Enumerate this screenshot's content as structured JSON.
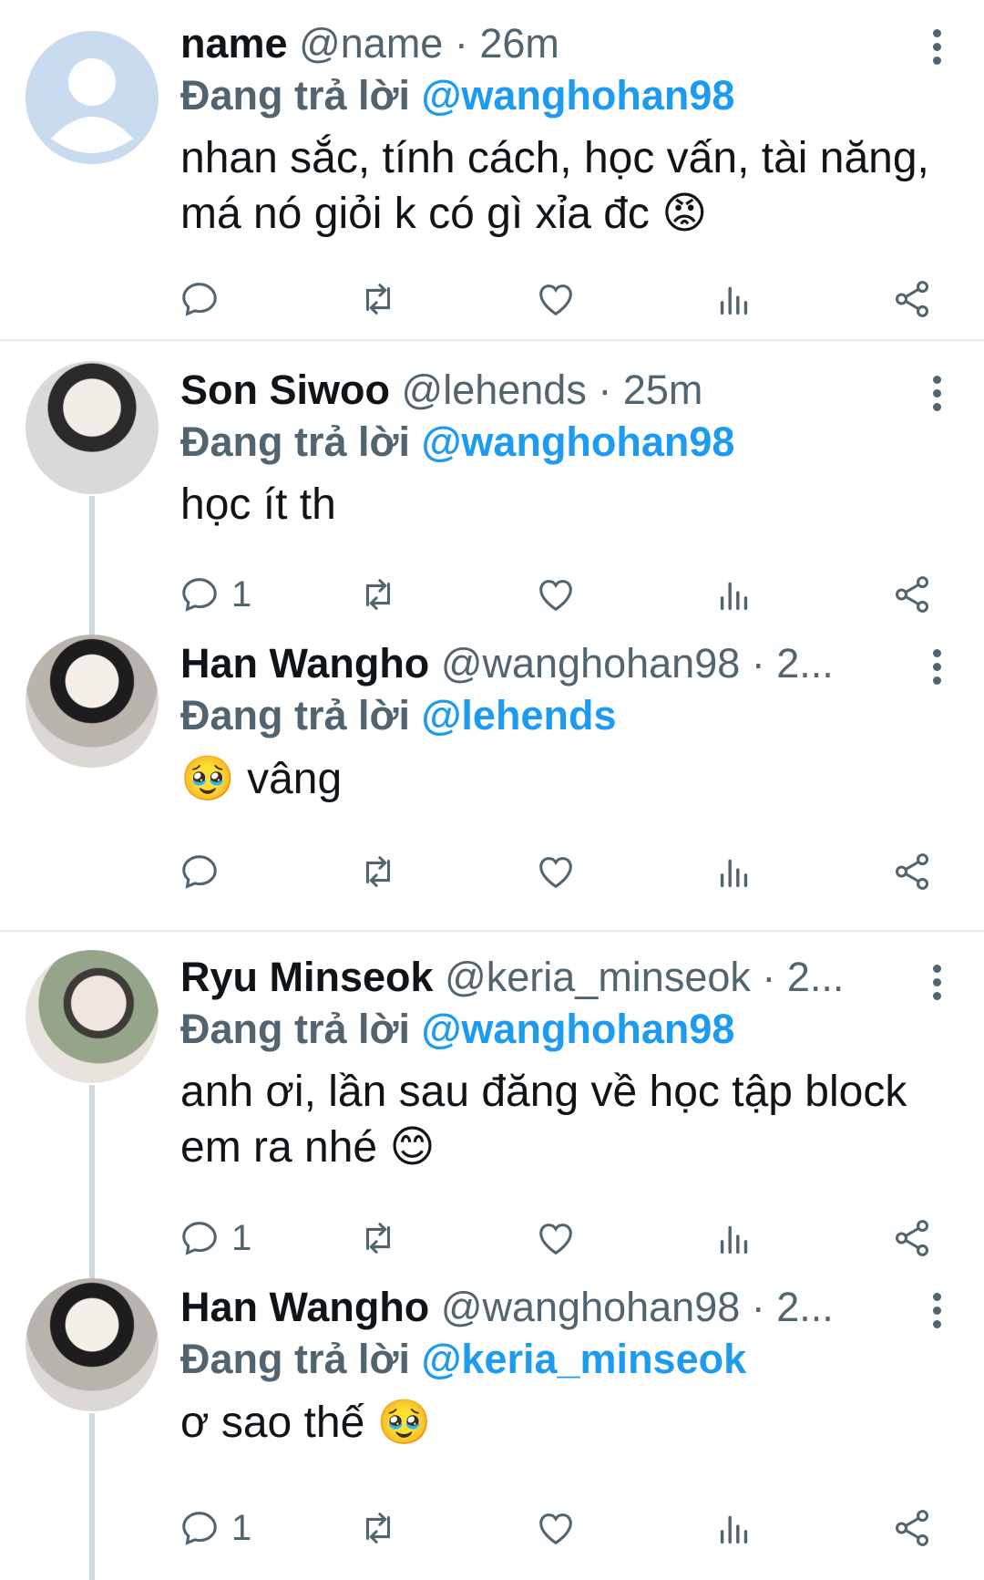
{
  "reply_prefix": "Đang trả lời",
  "tweets": [
    {
      "name": "name",
      "handle": "@name",
      "time": "· 26m",
      "reply_to": "@wanghohan98",
      "text": "nhan sắc, tính cách, học vấn, tài năng, má nó giỏi k có gì xỉa đc",
      "emoji": "😡",
      "reply_count": ""
    },
    {
      "name": "Son Siwoo",
      "handle": "@lehends",
      "time": "· 25m",
      "reply_to": "@wanghohan98",
      "text": "học ít th",
      "emoji": "",
      "reply_count": "1"
    },
    {
      "name": "Han Wangho",
      "handle": "@wanghohan98",
      "time": "· 2...",
      "reply_to": "@lehends",
      "text": "vâng",
      "emoji": "🥹",
      "reply_count": ""
    },
    {
      "name": "Ryu Minseok",
      "handle": "@keria_minseok",
      "time": "· 2...",
      "reply_to": "@wanghohan98",
      "text": "anh ơi, lần sau đăng về học tập block em ra nhé",
      "emoji": "😊",
      "reply_count": "1"
    },
    {
      "name": "Han Wangho",
      "handle": "@wanghohan98",
      "time": "· 2...",
      "reply_to": "@keria_minseok",
      "text": "ơ sao thế",
      "emoji": "🥹",
      "reply_count": "1"
    }
  ],
  "icons": [
    "reply-icon",
    "retweet-icon",
    "like-icon",
    "views-icon",
    "share-icon",
    "more-icon",
    "avatar-icon"
  ]
}
